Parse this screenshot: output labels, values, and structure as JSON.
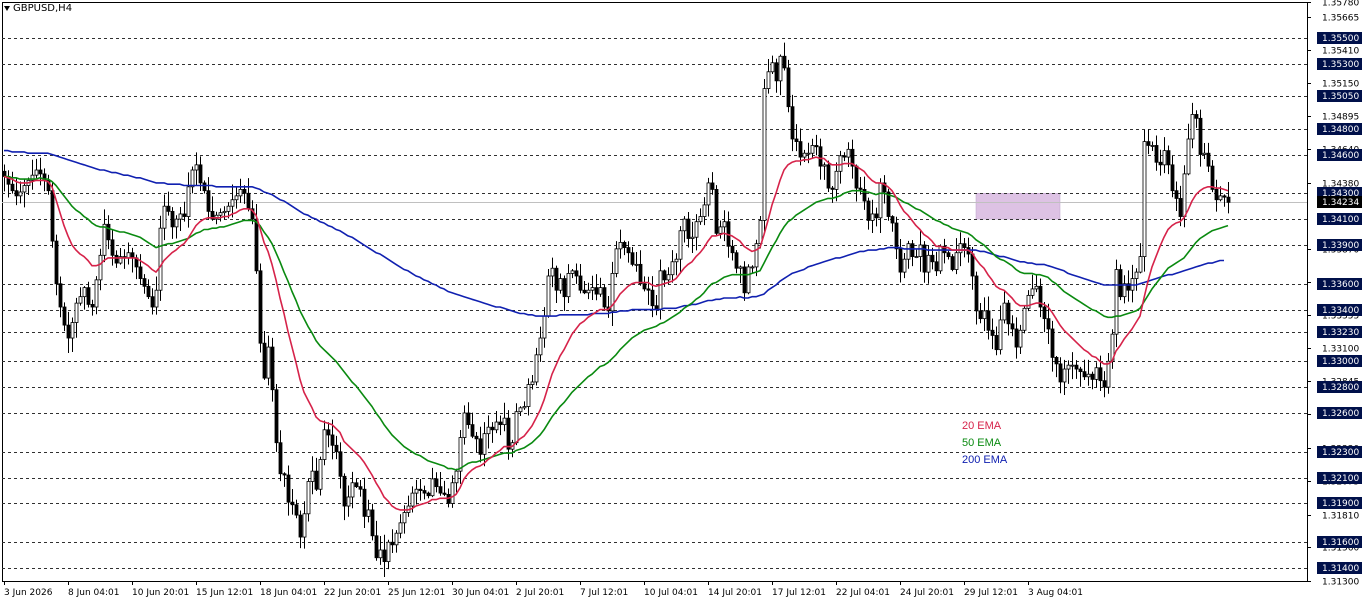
{
  "symbol": "GBPUSD,H4",
  "colors": {
    "ema20": "#d6234a",
    "ema50": "#0a8a10",
    "ema200": "#1020b0",
    "highlight": "#d8b8e0",
    "highlight_border": "#b090c0",
    "label_bg": "#00104a",
    "current_bg": "#000000",
    "grid": "#303030",
    "candle": "#000000"
  },
  "legend": [
    {
      "label": "20 EMA",
      "color": "#d6234a"
    },
    {
      "label": "50 EMA",
      "color": "#0a8a10"
    },
    {
      "label": "200 EMA",
      "color": "#1020b0"
    }
  ],
  "chart_data": {
    "type": "candlestick",
    "timeframe": "H4",
    "ylim": [
      1.313,
      1.3578
    ],
    "price_ticks": [
      1.3578,
      1.35665,
      1.3541,
      1.3515,
      1.34895,
      1.3464,
      1.3438,
      1.3387,
      1.3361,
      1.33355,
      1.331,
      1.32845,
      1.3259,
      1.3233,
      1.32075,
      1.3181,
      1.3156,
      1.313
    ],
    "dashed_levels": [
      1.355,
      1.353,
      1.3505,
      1.348,
      1.346,
      1.343,
      1.341,
      1.339,
      1.336,
      1.334,
      1.3323,
      1.33,
      1.328,
      1.326,
      1.323,
      1.321,
      1.319,
      1.316,
      1.314
    ],
    "current_price": 1.34234,
    "time_labels": [
      "3 Jun 2026",
      "8 Jun 04:01",
      "10 Jun 20:01",
      "15 Jun 12:01",
      "18 Jun 04:01",
      "22 Jun 20:01",
      "25 Jun 12:01",
      "30 Jun 04:01",
      "2 Jul 20:01",
      "7 Jul 12:01",
      "10 Jul 04:01",
      "14 Jul 20:01",
      "17 Jul 12:01",
      "22 Jul 04:01",
      "24 Jul 20:01",
      "29 Jul 12:01",
      "3 Aug 04:01"
    ],
    "time_label_candle_index": [
      0,
      16,
      32,
      48,
      64,
      80,
      96,
      112,
      128,
      144,
      160,
      176,
      192,
      208,
      224,
      240,
      256
    ],
    "highlight_zone": {
      "from": 1.341,
      "to": 1.343,
      "candle_from": 243,
      "candle_to": 264
    },
    "closes": [
      1.3443,
      1.3437,
      1.3432,
      1.3428,
      1.3431,
      1.3436,
      1.344,
      1.3444,
      1.3448,
      1.3445,
      1.344,
      1.3432,
      1.3393,
      1.336,
      1.3342,
      1.3328,
      1.3318,
      1.333,
      1.3345,
      1.335,
      1.3357,
      1.3344,
      1.3342,
      1.3363,
      1.3382,
      1.3406,
      1.3394,
      1.3382,
      1.3376,
      1.3381,
      1.338,
      1.3384,
      1.338,
      1.3373,
      1.3364,
      1.3358,
      1.335,
      1.3342,
      1.3355,
      1.3403,
      1.342,
      1.3416,
      1.3404,
      1.341,
      1.3414,
      1.3412,
      1.3435,
      1.3448,
      1.3452,
      1.3438,
      1.3432,
      1.3416,
      1.341,
      1.3413,
      1.3415,
      1.3416,
      1.342,
      1.3425,
      1.3428,
      1.3433,
      1.343,
      1.3418,
      1.341,
      1.337,
      1.3314,
      1.3287,
      1.3311,
      1.3278,
      1.3237,
      1.3213,
      1.3212,
      1.3191,
      1.3189,
      1.3181,
      1.3164,
      1.3182,
      1.3207,
      1.3215,
      1.3201,
      1.3224,
      1.3247,
      1.3243,
      1.3235,
      1.323,
      1.3211,
      1.3188,
      1.3195,
      1.3206,
      1.3203,
      1.3201,
      1.318,
      1.3185,
      1.3165,
      1.3148,
      1.3154,
      1.3145,
      1.316,
      1.3158,
      1.3167,
      1.3175,
      1.3183,
      1.3188,
      1.3198,
      1.3201,
      1.32,
      1.3198,
      1.3196,
      1.3209,
      1.3203,
      1.3198,
      1.3197,
      1.319,
      1.3206,
      1.3215,
      1.3241,
      1.326,
      1.3251,
      1.3242,
      1.324,
      1.3228,
      1.3244,
      1.3249,
      1.3247,
      1.3253,
      1.3251,
      1.3256,
      1.3232,
      1.3237,
      1.3261,
      1.3264,
      1.3265,
      1.3282,
      1.3284,
      1.3305,
      1.3318,
      1.3335,
      1.3366,
      1.3372,
      1.3355,
      1.3364,
      1.335,
      1.3368,
      1.337,
      1.3366,
      1.3355,
      1.3353,
      1.3355,
      1.3357,
      1.3352,
      1.3357,
      1.3342,
      1.3339,
      1.3368,
      1.3387,
      1.3392,
      1.3388,
      1.3384,
      1.3375,
      1.3375,
      1.336,
      1.3356,
      1.3355,
      1.3343,
      1.334,
      1.337,
      1.3363,
      1.3367,
      1.3377,
      1.3379,
      1.3401,
      1.341,
      1.3395,
      1.3396,
      1.3408,
      1.3412,
      1.3421,
      1.3438,
      1.3433,
      1.3399,
      1.3404,
      1.3408,
      1.3389,
      1.3384,
      1.3372,
      1.3373,
      1.3353,
      1.3373,
      1.3373,
      1.3391,
      1.3409,
      1.3511,
      1.3524,
      1.3531,
      1.3517,
      1.3536,
      1.3527,
      1.3497,
      1.3472,
      1.347,
      1.3458,
      1.3461,
      1.3461,
      1.3467,
      1.3466,
      1.3451,
      1.3452,
      1.3434,
      1.3433,
      1.3447,
      1.3459,
      1.3458,
      1.3464,
      1.3451,
      1.3434,
      1.3433,
      1.3424,
      1.3409,
      1.3414,
      1.3411,
      1.3438,
      1.3431,
      1.3412,
      1.3407,
      1.3387,
      1.3369,
      1.3379,
      1.3391,
      1.3381,
      1.3381,
      1.339,
      1.3369,
      1.3382,
      1.3377,
      1.337,
      1.3389,
      1.3384,
      1.3381,
      1.3371,
      1.3384,
      1.3391,
      1.3388,
      1.3383,
      1.3366,
      1.3339,
      1.3333,
      1.3339,
      1.3324,
      1.332,
      1.3309,
      1.3332,
      1.3345,
      1.3329,
      1.3325,
      1.3311,
      1.3324,
      1.3341,
      1.3351,
      1.3356,
      1.3358,
      1.3342,
      1.3333,
      1.3325,
      1.3303,
      1.3298,
      1.3284,
      1.3294,
      1.3297,
      1.3297,
      1.3294,
      1.3292,
      1.3288,
      1.329,
      1.3286,
      1.3295,
      1.3285,
      1.328,
      1.33,
      1.3321,
      1.3371,
      1.335,
      1.336,
      1.3355,
      1.3364,
      1.3369,
      1.3381,
      1.347,
      1.3467,
      1.3467,
      1.3454,
      1.3452,
      1.3463,
      1.3452,
      1.3432,
      1.3426,
      1.3412,
      1.3445,
      1.3472,
      1.3491,
      1.3488,
      1.346,
      1.3461,
      1.3451,
      1.3433,
      1.3425,
      1.3428,
      1.3427,
      1.3423
    ],
    "ema20": [
      1.3443,
      1.3442,
      1.3441,
      1.3439,
      1.3438,
      1.3438,
      1.3438,
      1.3439,
      1.344,
      1.344,
      1.344,
      1.3439,
      1.3435,
      1.3425,
      1.3415,
      1.3405,
      1.3397,
      1.339,
      1.3386,
      1.3383,
      1.3381,
      1.3378,
      1.3374,
      1.3374,
      1.3375,
      1.3378,
      1.338,
      1.338,
      1.338,
      1.338,
      1.338,
      1.338,
      1.338,
      1.338,
      1.3378,
      1.3376,
      1.3374,
      1.3371,
      1.3369,
      1.3373,
      1.3378,
      1.3381,
      1.3384,
      1.3386,
      1.3389,
      1.3391,
      1.3395,
      1.34,
      1.3405,
      1.3408,
      1.341,
      1.3411,
      1.3411,
      1.3411,
      1.3411,
      1.3412,
      1.3412,
      1.3414,
      1.3415,
      1.3417,
      1.3418,
      1.3418,
      1.3417,
      1.3413,
      1.3403,
      1.3392,
      1.3385,
      1.3375,
      1.3363,
      1.3349,
      1.3337,
      1.3323,
      1.3311,
      1.3299,
      1.3286,
      1.3276,
      1.327,
      1.3264,
      1.3257,
      1.3254,
      1.3253,
      1.3252,
      1.3251,
      1.3248,
      1.3245,
      1.3238,
      1.3235,
      1.3232,
      1.3229,
      1.3226,
      1.3222,
      1.3217,
      1.3212,
      1.3206,
      1.3201,
      1.3195,
      1.3192,
      1.3188,
      1.3186,
      1.3185,
      1.3185,
      1.3185,
      1.3186,
      1.3188,
      1.3189,
      1.319,
      1.3191,
      1.3193,
      1.3193,
      1.3194,
      1.3194,
      1.3194,
      1.3195,
      1.3197,
      1.3202,
      1.3209,
      1.3213,
      1.3216,
      1.3218,
      1.3219,
      1.3221,
      1.3224,
      1.3226,
      1.3229,
      1.3231,
      1.3234,
      1.3234,
      1.3234,
      1.3237,
      1.324,
      1.3242,
      1.3246,
      1.325,
      1.3256,
      1.3262,
      1.327,
      1.328,
      1.329,
      1.3297,
      1.3304,
      1.3309,
      1.3315,
      1.3321,
      1.3325,
      1.3329,
      1.3331,
      1.3334,
      1.3336,
      1.3338,
      1.334,
      1.334,
      1.334,
      1.3343,
      1.3347,
      1.3352,
      1.3355,
      1.3358,
      1.336,
      1.3361,
      1.3361,
      1.3361,
      1.3361,
      1.3359,
      1.3358,
      1.3359,
      1.336,
      1.3361,
      1.3362,
      1.3364,
      1.3368,
      1.3372,
      1.3375,
      1.3377,
      1.3381,
      1.3384,
      1.3388,
      1.3393,
      1.3397,
      1.3397,
      1.3398,
      1.3399,
      1.3398,
      1.3397,
      1.3395,
      1.3393,
      1.3389,
      1.3387,
      1.3385,
      1.3386,
      1.3388,
      1.3398,
      1.3409,
      1.3421,
      1.343,
      1.344,
      1.3448,
      1.3452,
      1.3454,
      1.3455,
      1.3455,
      1.3456,
      1.3456,
      1.3457,
      1.3458,
      1.3457,
      1.3457,
      1.3454,
      1.3452,
      1.3452,
      1.3452,
      1.3453,
      1.3453,
      1.3453,
      1.3451,
      1.3449,
      1.3447,
      1.3443,
      1.344,
      1.3438,
      1.3438,
      1.3437,
      1.3435,
      1.3432,
      1.3427,
      1.3421,
      1.3416,
      1.3413,
      1.3409,
      1.3405,
      1.3402,
      1.3398,
      1.3396,
      1.3393,
      1.3389,
      1.3389,
      1.3388,
      1.3388,
      1.3386,
      1.3386,
      1.3386,
      1.3386,
      1.3386,
      1.3384,
      1.3379,
      1.3375,
      1.3372,
      1.3367,
      1.3363,
      1.3358,
      1.3356,
      1.3355,
      1.3352,
      1.3349,
      1.3345,
      1.3343,
      1.3343,
      1.3343,
      1.3344,
      1.3345,
      1.3345,
      1.3344,
      1.3342,
      1.3338,
      1.3333,
      1.3328,
      1.3324,
      1.3321,
      1.3318,
      1.3315,
      1.3312,
      1.3309,
      1.3307,
      1.3304,
      1.3303,
      1.33,
      1.3298,
      1.3298,
      1.33,
      1.3308,
      1.3312,
      1.3317,
      1.3321,
      1.3325,
      1.333,
      1.3335,
      1.3349,
      1.3362,
      1.3373,
      1.3381,
      1.3389,
      1.3396,
      1.3402,
      1.3405,
      1.3407,
      1.3408,
      1.3411,
      1.3417,
      1.3424,
      1.3429,
      1.3432,
      1.3434,
      1.3435,
      1.3435,
      1.3434,
      1.3434,
      1.3433,
      1.3432
    ],
    "ema50": [
      1.3443,
      1.3443,
      1.3442,
      1.3442,
      1.3441,
      1.3441,
      1.3441,
      1.3441,
      1.3441,
      1.3442,
      1.3441,
      1.3441,
      1.3439,
      1.3436,
      1.3432,
      1.3428,
      1.3424,
      1.342,
      1.3417,
      1.3415,
      1.3412,
      1.341,
      1.3407,
      1.3405,
      1.3404,
      1.3404,
      1.3403,
      1.3402,
      1.3401,
      1.34,
      1.34,
      1.3399,
      1.3398,
      1.3397,
      1.3396,
      1.3394,
      1.3392,
      1.339,
      1.3388,
      1.3389,
      1.339,
      1.3391,
      1.3391,
      1.3392,
      1.3393,
      1.3394,
      1.3395,
      1.3397,
      1.3399,
      1.34,
      1.3402,
      1.3402,
      1.3403,
      1.3403,
      1.3404,
      1.3404,
      1.3405,
      1.3406,
      1.3407,
      1.3408,
      1.3409,
      1.3409,
      1.3409,
      1.3408,
      1.3405,
      1.34,
      1.3396,
      1.3391,
      1.3384,
      1.3377,
      1.3369,
      1.3362,
      1.3354,
      1.3347,
      1.3339,
      1.3333,
      1.3327,
      1.3322,
      1.3316,
      1.3312,
      1.3309,
      1.3306,
      1.3303,
      1.33,
      1.3296,
      1.3292,
      1.3288,
      1.3284,
      1.3281,
      1.3277,
      1.3273,
      1.3269,
      1.3265,
      1.326,
      1.3256,
      1.3251,
      1.3247,
      1.3243,
      1.324,
      1.3237,
      1.3234,
      1.3232,
      1.323,
      1.3228,
      1.3227,
      1.3225,
      1.3223,
      1.3222,
      1.3221,
      1.322,
      1.3219,
      1.3217,
      1.3217,
      1.3216,
      1.3217,
      1.3219,
      1.3221,
      1.3222,
      1.3222,
      1.3223,
      1.3224,
      1.3225,
      1.3226,
      1.3227,
      1.3228,
      1.3229,
      1.3229,
      1.3229,
      1.3231,
      1.3232,
      1.3233,
      1.3235,
      1.3237,
      1.324,
      1.3243,
      1.3247,
      1.3252,
      1.3257,
      1.3261,
      1.3265,
      1.3268,
      1.3272,
      1.3276,
      1.3279,
      1.3282,
      1.3285,
      1.3288,
      1.329,
      1.3293,
      1.3296,
      1.3297,
      1.3299,
      1.3302,
      1.3305,
      1.3309,
      1.3312,
      1.3315,
      1.3318,
      1.332,
      1.3322,
      1.3324,
      1.3325,
      1.3326,
      1.3327,
      1.3329,
      1.333,
      1.3332,
      1.3334,
      1.3336,
      1.3338,
      1.3341,
      1.3343,
      1.3345,
      1.3348,
      1.335,
      1.3353,
      1.3357,
      1.336,
      1.3361,
      1.3363,
      1.3365,
      1.3366,
      1.3367,
      1.3367,
      1.3367,
      1.3367,
      1.3367,
      1.3368,
      1.3369,
      1.337,
      1.3376,
      1.3382,
      1.3388,
      1.3393,
      1.3399,
      1.3404,
      1.3408,
      1.341,
      1.3413,
      1.3415,
      1.3417,
      1.3419,
      1.3421,
      1.3423,
      1.3424,
      1.3425,
      1.3426,
      1.3426,
      1.3427,
      1.3428,
      1.343,
      1.3431,
      1.3432,
      1.3432,
      1.3432,
      1.3431,
      1.3431,
      1.343,
      1.3429,
      1.343,
      1.343,
      1.3429,
      1.3428,
      1.3427,
      1.3425,
      1.3423,
      1.3422,
      1.342,
      1.3418,
      1.3417,
      1.3415,
      1.3413,
      1.3411,
      1.3409,
      1.3408,
      1.3406,
      1.3405,
      1.3403,
      1.3402,
      1.3401,
      1.34,
      1.3399,
      1.3397,
      1.3394,
      1.3392,
      1.339,
      1.3387,
      1.3384,
      1.3381,
      1.3379,
      1.3378,
      1.3376,
      1.3374,
      1.3371,
      1.3369,
      1.3368,
      1.3368,
      1.3368,
      1.3367,
      1.3367,
      1.3366,
      1.3365,
      1.3362,
      1.336,
      1.3357,
      1.3354,
      1.3352,
      1.335,
      1.3348,
      1.3346,
      1.3344,
      1.3342,
      1.334,
      1.3339,
      1.3337,
      1.3335,
      1.3334,
      1.3334,
      1.3335,
      1.3335,
      1.3336,
      1.3337,
      1.3338,
      1.3339,
      1.3341,
      1.3346,
      1.3351,
      1.3356,
      1.336,
      1.3364,
      1.3368,
      1.3372,
      1.3374,
      1.3376,
      1.3378,
      1.338,
      1.3384,
      1.3388,
      1.3392,
      1.3395,
      1.3397,
      1.3399,
      1.3401,
      1.3402,
      1.3403,
      1.3404,
      1.3405
    ],
    "ema200": [
      1.3463,
      1.3463,
      1.3462,
      1.3462,
      1.3462,
      1.3462,
      1.3461,
      1.3461,
      1.3461,
      1.3461,
      1.3461,
      1.3461,
      1.346,
      1.3459,
      1.3458,
      1.3457,
      1.3456,
      1.3455,
      1.3454,
      1.3453,
      1.3452,
      1.3451,
      1.345,
      1.3449,
      1.3448,
      1.3448,
      1.3447,
      1.3446,
      1.3446,
      1.3445,
      1.3444,
      1.3444,
      1.3443,
      1.3442,
      1.3442,
      1.3441,
      1.344,
      1.3439,
      1.3438,
      1.3438,
      1.3438,
      1.3437,
      1.3437,
      1.3437,
      1.3437,
      1.3436,
      1.3436,
      1.3436,
      1.3436,
      1.3436,
      1.3436,
      1.3436,
      1.3436,
      1.3435,
      1.3435,
      1.3435,
      1.3435,
      1.3435,
      1.3435,
      1.3435,
      1.3435,
      1.3435,
      1.3435,
      1.3434,
      1.3433,
      1.3431,
      1.343,
      1.3429,
      1.3427,
      1.3425,
      1.3424,
      1.3422,
      1.342,
      1.3418,
      1.3416,
      1.3414,
      1.3413,
      1.3411,
      1.341,
      1.3408,
      1.3407,
      1.3405,
      1.3404,
      1.3402,
      1.3401,
      1.3399,
      1.3397,
      1.3396,
      1.3394,
      1.3392,
      1.339,
      1.3388,
      1.3386,
      1.3384,
      1.3383,
      1.3381,
      1.3379,
      1.3377,
      1.3375,
      1.3373,
      1.3371,
      1.337,
      1.3368,
      1.3366,
      1.3365,
      1.3363,
      1.3362,
      1.336,
      1.3359,
      1.3357,
      1.3356,
      1.3354,
      1.3353,
      1.3352,
      1.3351,
      1.335,
      1.3349,
      1.3348,
      1.3347,
      1.3346,
      1.3345,
      1.3344,
      1.3343,
      1.3342,
      1.3342,
      1.3341,
      1.334,
      1.3339,
      1.3338,
      1.3337,
      1.3337,
      1.3336,
      1.3336,
      1.3335,
      1.3335,
      1.3335,
      1.3335,
      1.3335,
      1.3335,
      1.3336,
      1.3336,
      1.3336,
      1.3336,
      1.3336,
      1.3336,
      1.3336,
      1.3336,
      1.3337,
      1.3337,
      1.3337,
      1.3337,
      1.3337,
      1.3338,
      1.3338,
      1.3339,
      1.3339,
      1.3339,
      1.334,
      1.334,
      1.334,
      1.334,
      1.334,
      1.334,
      1.334,
      1.334,
      1.3341,
      1.3341,
      1.3341,
      1.3341,
      1.3342,
      1.3343,
      1.3343,
      1.3344,
      1.3344,
      1.3345,
      1.3346,
      1.3347,
      1.3347,
      1.3348,
      1.3348,
      1.3349,
      1.3349,
      1.3349,
      1.3349,
      1.335,
      1.3349,
      1.3349,
      1.335,
      1.335,
      1.3351,
      1.3352,
      1.3355,
      1.3357,
      1.3359,
      1.3362,
      1.3364,
      1.3366,
      1.3368,
      1.3369,
      1.337,
      1.3371,
      1.3373,
      1.3374,
      1.3375,
      1.3376,
      1.3377,
      1.3378,
      1.3379,
      1.338,
      1.338,
      1.3381,
      1.3382,
      1.3383,
      1.3384,
      1.3385,
      1.3385,
      1.3386,
      1.3386,
      1.3386,
      1.3387,
      1.3387,
      1.3388,
      1.3388,
      1.3388,
      1.3388,
      1.3387,
      1.3387,
      1.3387,
      1.3387,
      1.3387,
      1.3387,
      1.3386,
      1.3386,
      1.3386,
      1.3386,
      1.3386,
      1.3386,
      1.3386,
      1.3386,
      1.3386,
      1.3386,
      1.3386,
      1.3386,
      1.3386,
      1.3385,
      1.3385,
      1.3384,
      1.3383,
      1.3382,
      1.3381,
      1.3381,
      1.338,
      1.3379,
      1.3378,
      1.3377,
      1.3377,
      1.3376,
      1.3376,
      1.3375,
      1.3375,
      1.3375,
      1.3374,
      1.3373,
      1.3372,
      1.3371,
      1.337,
      1.3368,
      1.3367,
      1.3366,
      1.3365,
      1.3364,
      1.3363,
      1.3362,
      1.3361,
      1.336,
      1.3359,
      1.3359,
      1.3359,
      1.3359,
      1.3359,
      1.3359,
      1.3359,
      1.3359,
      1.3359,
      1.336,
      1.3361,
      1.3362,
      1.3363,
      1.3364,
      1.3365,
      1.3366,
      1.3367,
      1.3367,
      1.3368,
      1.3369,
      1.337,
      1.3371,
      1.3372,
      1.3373,
      1.3374,
      1.3375,
      1.3376,
      1.3376,
      1.3377,
      1.3378,
      1.3378
    ]
  }
}
